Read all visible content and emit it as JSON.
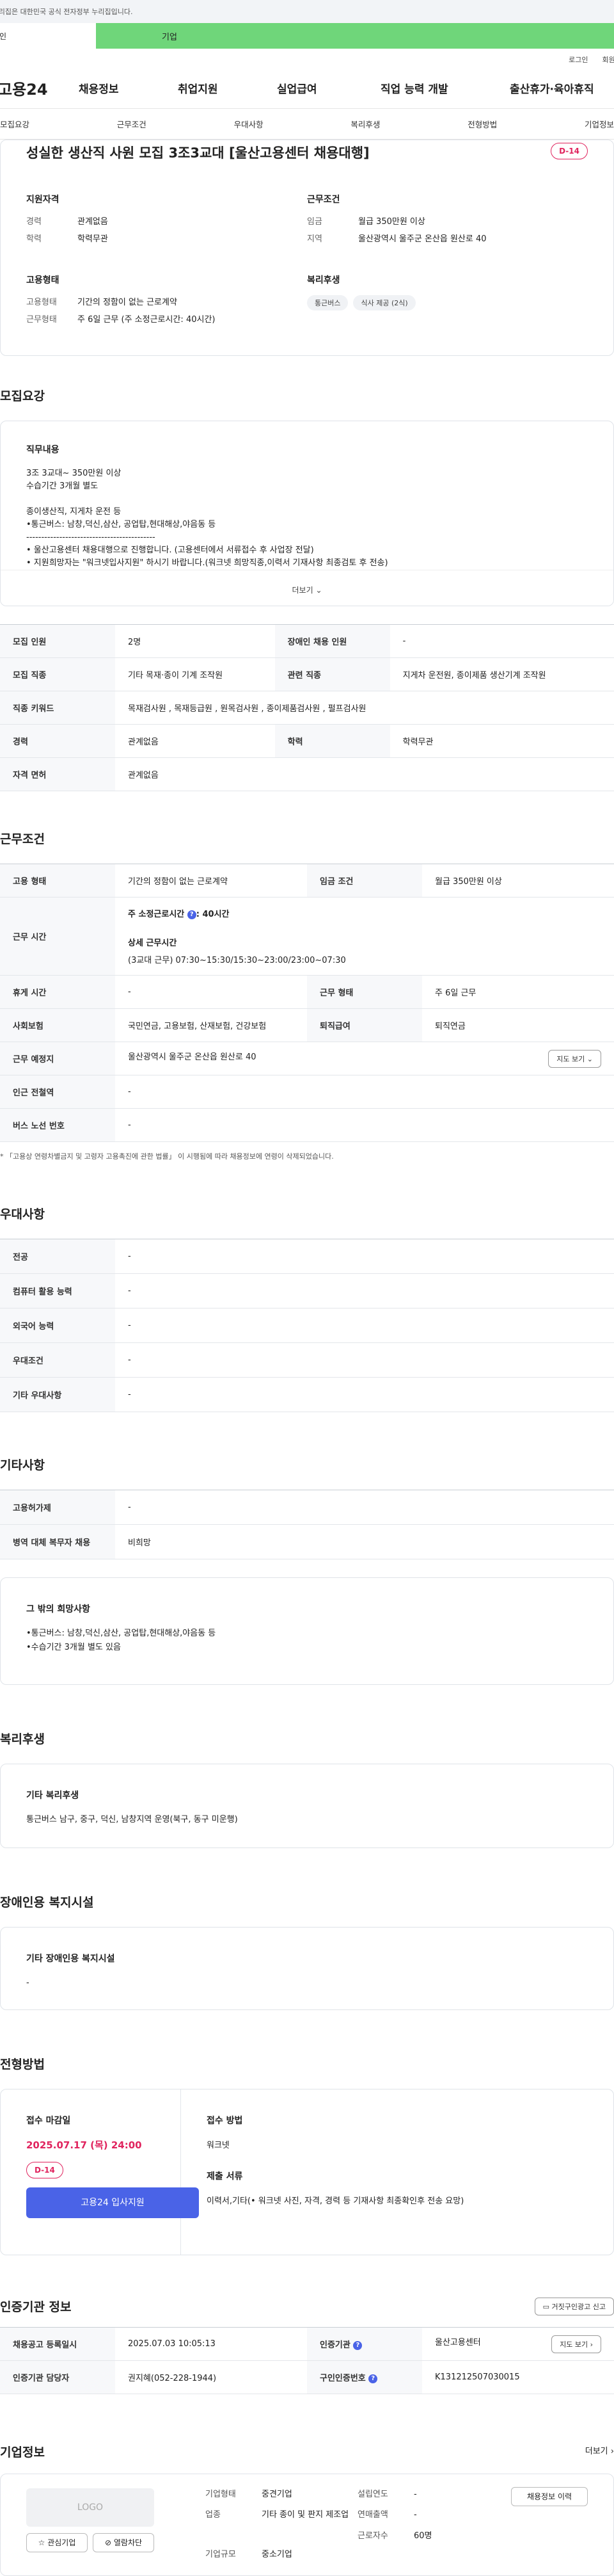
{
  "gov_notice": "이 누리집은 대한민국 공식 전자정부 누리집입니다.",
  "tabs": {
    "person": "개인",
    "company": "기업"
  },
  "util": {
    "login": "로그인",
    "signup": "회원가입"
  },
  "gnb": {
    "logo": "고용24",
    "items": [
      "채용정보",
      "취업지원",
      "실업급여",
      "직업 능력 개발",
      "출산휴가·육아휴직"
    ]
  },
  "anchors": [
    "모집요강",
    "근무조건",
    "우대사항",
    "복리후생",
    "전형방법",
    "기업정보"
  ],
  "summary": {
    "title": "성실한 생산직 사원 모집 3조3교대 [울산고용센터 채용대행]",
    "dday": "D-14",
    "qual": {
      "title": "지원자격",
      "career_k": "경력",
      "career_v": "관계없음",
      "edu_k": "학력",
      "edu_v": "학력무관"
    },
    "cond": {
      "title": "근무조건",
      "wage_k": "임금",
      "wage_v": "월급 350만원 이상",
      "area_k": "지역",
      "area_v": "울산광역시 울주군 온산읍 원산로 40"
    },
    "emp": {
      "title": "고용형태",
      "type_k": "고용형태",
      "type_v": "기간의 정함이 없는 근로계약",
      "work_k": "근무형태",
      "work_v": "주 6일 근무 (주 소정근로시간: 40시간)"
    },
    "welfare": {
      "title": "복리후생",
      "chips": [
        "통근버스",
        "식사 제공 (2식)"
      ]
    }
  },
  "recruit": {
    "title": "모집요강",
    "desc_title": "직무내용",
    "desc_text": "3조 3교대~ 350만원 이상\n수습기간 3개월 별도\n\n종이생산직, 지게차 운전 등\n•통근버스: 남창,덕신,삼산, 공업탑,현대해상,야음동 등\n-------------------------------------------\n• 울산고용센터 채용대행으로 진행합니다. (고용센터에서 서류접수 후 사업장 전달)\n• 지원희망자는 \"워크넷입사지원\" 하시기 바랍니다.(워크넷 희망직종,이력서 기재사항 최종검토 후 전송)\n• 서류합격자는 사업장에서 개별연락 드리며, 적합자 채용시 조기마감 될 수 있습니다.",
    "more": "더보기",
    "rows": [
      [
        "모집 인원",
        "2명",
        "장애인 채용 인원",
        "-"
      ],
      [
        "모집 직종",
        "기타 목재·종이 기계 조작원",
        "관련 직종",
        "지게차 운전원, 종이제품 생산기계 조작원"
      ],
      [
        "직종 키워드",
        "목재검사원 , 목재등급원 , 원목검사원 , 종이제품검사원 , 펄프검사원"
      ],
      [
        "경력",
        "관계없음",
        "학력",
        "학력무관"
      ],
      [
        "자격 면허",
        "관계없음"
      ]
    ]
  },
  "work": {
    "title": "근무조건",
    "emp_k": "고용 형태",
    "emp_v": "기간의 정함이 없는 근로계약",
    "wage_k": "임금 조건",
    "wage_v": "월급 350만원 이상",
    "hours_k": "근무 시간",
    "hours_main": "주 소정근로시간",
    "hours_main_v": ": 40시간",
    "hours_detail_t": "상세 근무시간",
    "hours_detail_v": "(3교대 근무) 07:30~15:30/15:30~23:00/23:00~07:30",
    "rest_k": "휴게 시간",
    "rest_v": "-",
    "form_k": "근무 형태",
    "form_v": "주 6일 근무",
    "ins_k": "사회보험",
    "ins_v": "국민연금, 고용보험, 산재보험, 건강보험",
    "pension_k": "퇴직급여",
    "pension_v": "퇴직연금",
    "place_k": "근무 예정지",
    "place_v": "울산광역시 울주군 온산읍 원산로 40",
    "map_btn": "지도 보기",
    "subway_k": "인근 전철역",
    "subway_v": "-",
    "bus_k": "버스 노선 번호",
    "bus_v": "-",
    "note": "* 「고용상 연령차별금지 및 고령자 고용촉진에 관한 법률」 이 시행됨에 따라 채용정보에 연령이 삭제되었습니다."
  },
  "pref": {
    "title": "우대사항",
    "rows": [
      [
        "전공",
        "-"
      ],
      [
        "컴퓨터 활용 능력",
        "-"
      ],
      [
        "외국어 능력",
        "-"
      ],
      [
        "우대조건",
        "-"
      ],
      [
        "기타 우대사항",
        "-"
      ]
    ]
  },
  "etc": {
    "title": "기타사항",
    "rows": [
      [
        "고용허가제",
        "-"
      ],
      [
        "병역 대체 복무자 채용",
        "비희망"
      ]
    ],
    "box_title": "그 밖의 희망사항",
    "box_text": "•통근버스: 남창,덕신,삼산, 공업탑,현대해상,야음동 등\n•수습기간 3개월 별도 있음"
  },
  "welfare": {
    "title": "복리후생",
    "box_title": "기타 복리후생",
    "box_text": "통근버스 남구, 중구, 덕신, 남창지역 운영(북구, 동구 미운행)"
  },
  "disability": {
    "title": "장애인용 복지시설",
    "box_title": "기타 장애인용 복지시설",
    "box_text": "-"
  },
  "selection": {
    "title": "전형방법",
    "deadline_t": "접수 마감일",
    "deadline_v": "2025.07.17 (목) 24:00",
    "dday": "D-14",
    "apply_btn": "고용24 입사지원",
    "method_t": "접수 방법",
    "method_v": "워크넷",
    "docs_t": "제출 서류",
    "docs_v": "이력서,기타(• 워크넷 사진, 자격, 경력 등 기재사항 최종확인후 전송 요망)"
  },
  "auth": {
    "title": "인증기관 정보",
    "report_btn": "거짓구인광고 신고",
    "reg_k": "채용공고 등록일시",
    "reg_v": "2025.07.03 10:05:13",
    "org_k": "인증기관",
    "org_v": "울산고용센터",
    "map_btn": "지도 보기",
    "mgr_k": "인증기관 담당자",
    "mgr_v": "권지혜(052-228-1944)",
    "no_k": "구인인증번호",
    "no_v": "K131212507030015"
  },
  "company": {
    "title": "기업정보",
    "more": "더보기",
    "logo": "LOGO",
    "fav_btn": "관심기업",
    "block_btn": "열람차단",
    "prev_btn": "채용정보 이력",
    "type_k": "기업형태",
    "type_v": "중견기업",
    "ind_k": "업종",
    "ind_v": "기타 종이 및 판지 제조업",
    "size_k": "기업규모",
    "size_v": "중소기업",
    "year_k": "설립연도",
    "year_v": "-",
    "sales_k": "연매출액",
    "sales_v": "-",
    "emp_k": "근로자수",
    "emp_v": "60명"
  }
}
